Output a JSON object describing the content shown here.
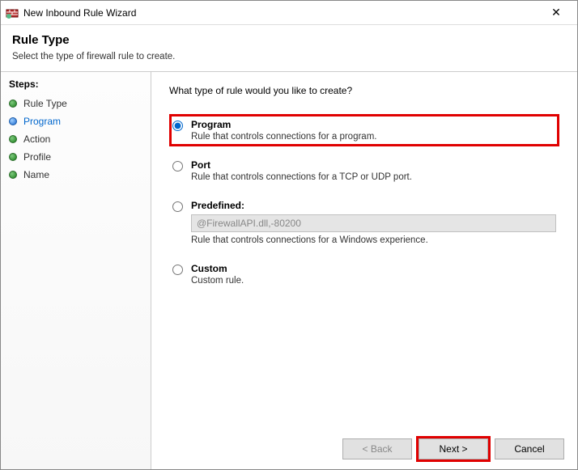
{
  "window": {
    "title": "New Inbound Rule Wizard",
    "close_glyph": "✕"
  },
  "header": {
    "title": "Rule Type",
    "subtitle": "Select the type of firewall rule to create."
  },
  "sidebar": {
    "label": "Steps:",
    "items": [
      {
        "label": "Rule Type"
      },
      {
        "label": "Program"
      },
      {
        "label": "Action"
      },
      {
        "label": "Profile"
      },
      {
        "label": "Name"
      }
    ]
  },
  "content": {
    "prompt": "What type of rule would you like to create?",
    "options": {
      "program": {
        "label": "Program",
        "desc": "Rule that controls connections for a program."
      },
      "port": {
        "label": "Port",
        "desc": "Rule that controls connections for a TCP or UDP port."
      },
      "predefined": {
        "label": "Predefined:",
        "select_value": "@FirewallAPI.dll,-80200",
        "desc": "Rule that controls connections for a Windows experience."
      },
      "custom": {
        "label": "Custom",
        "desc": "Custom rule."
      }
    }
  },
  "buttons": {
    "back": "< Back",
    "next": "Next >",
    "cancel": "Cancel"
  }
}
